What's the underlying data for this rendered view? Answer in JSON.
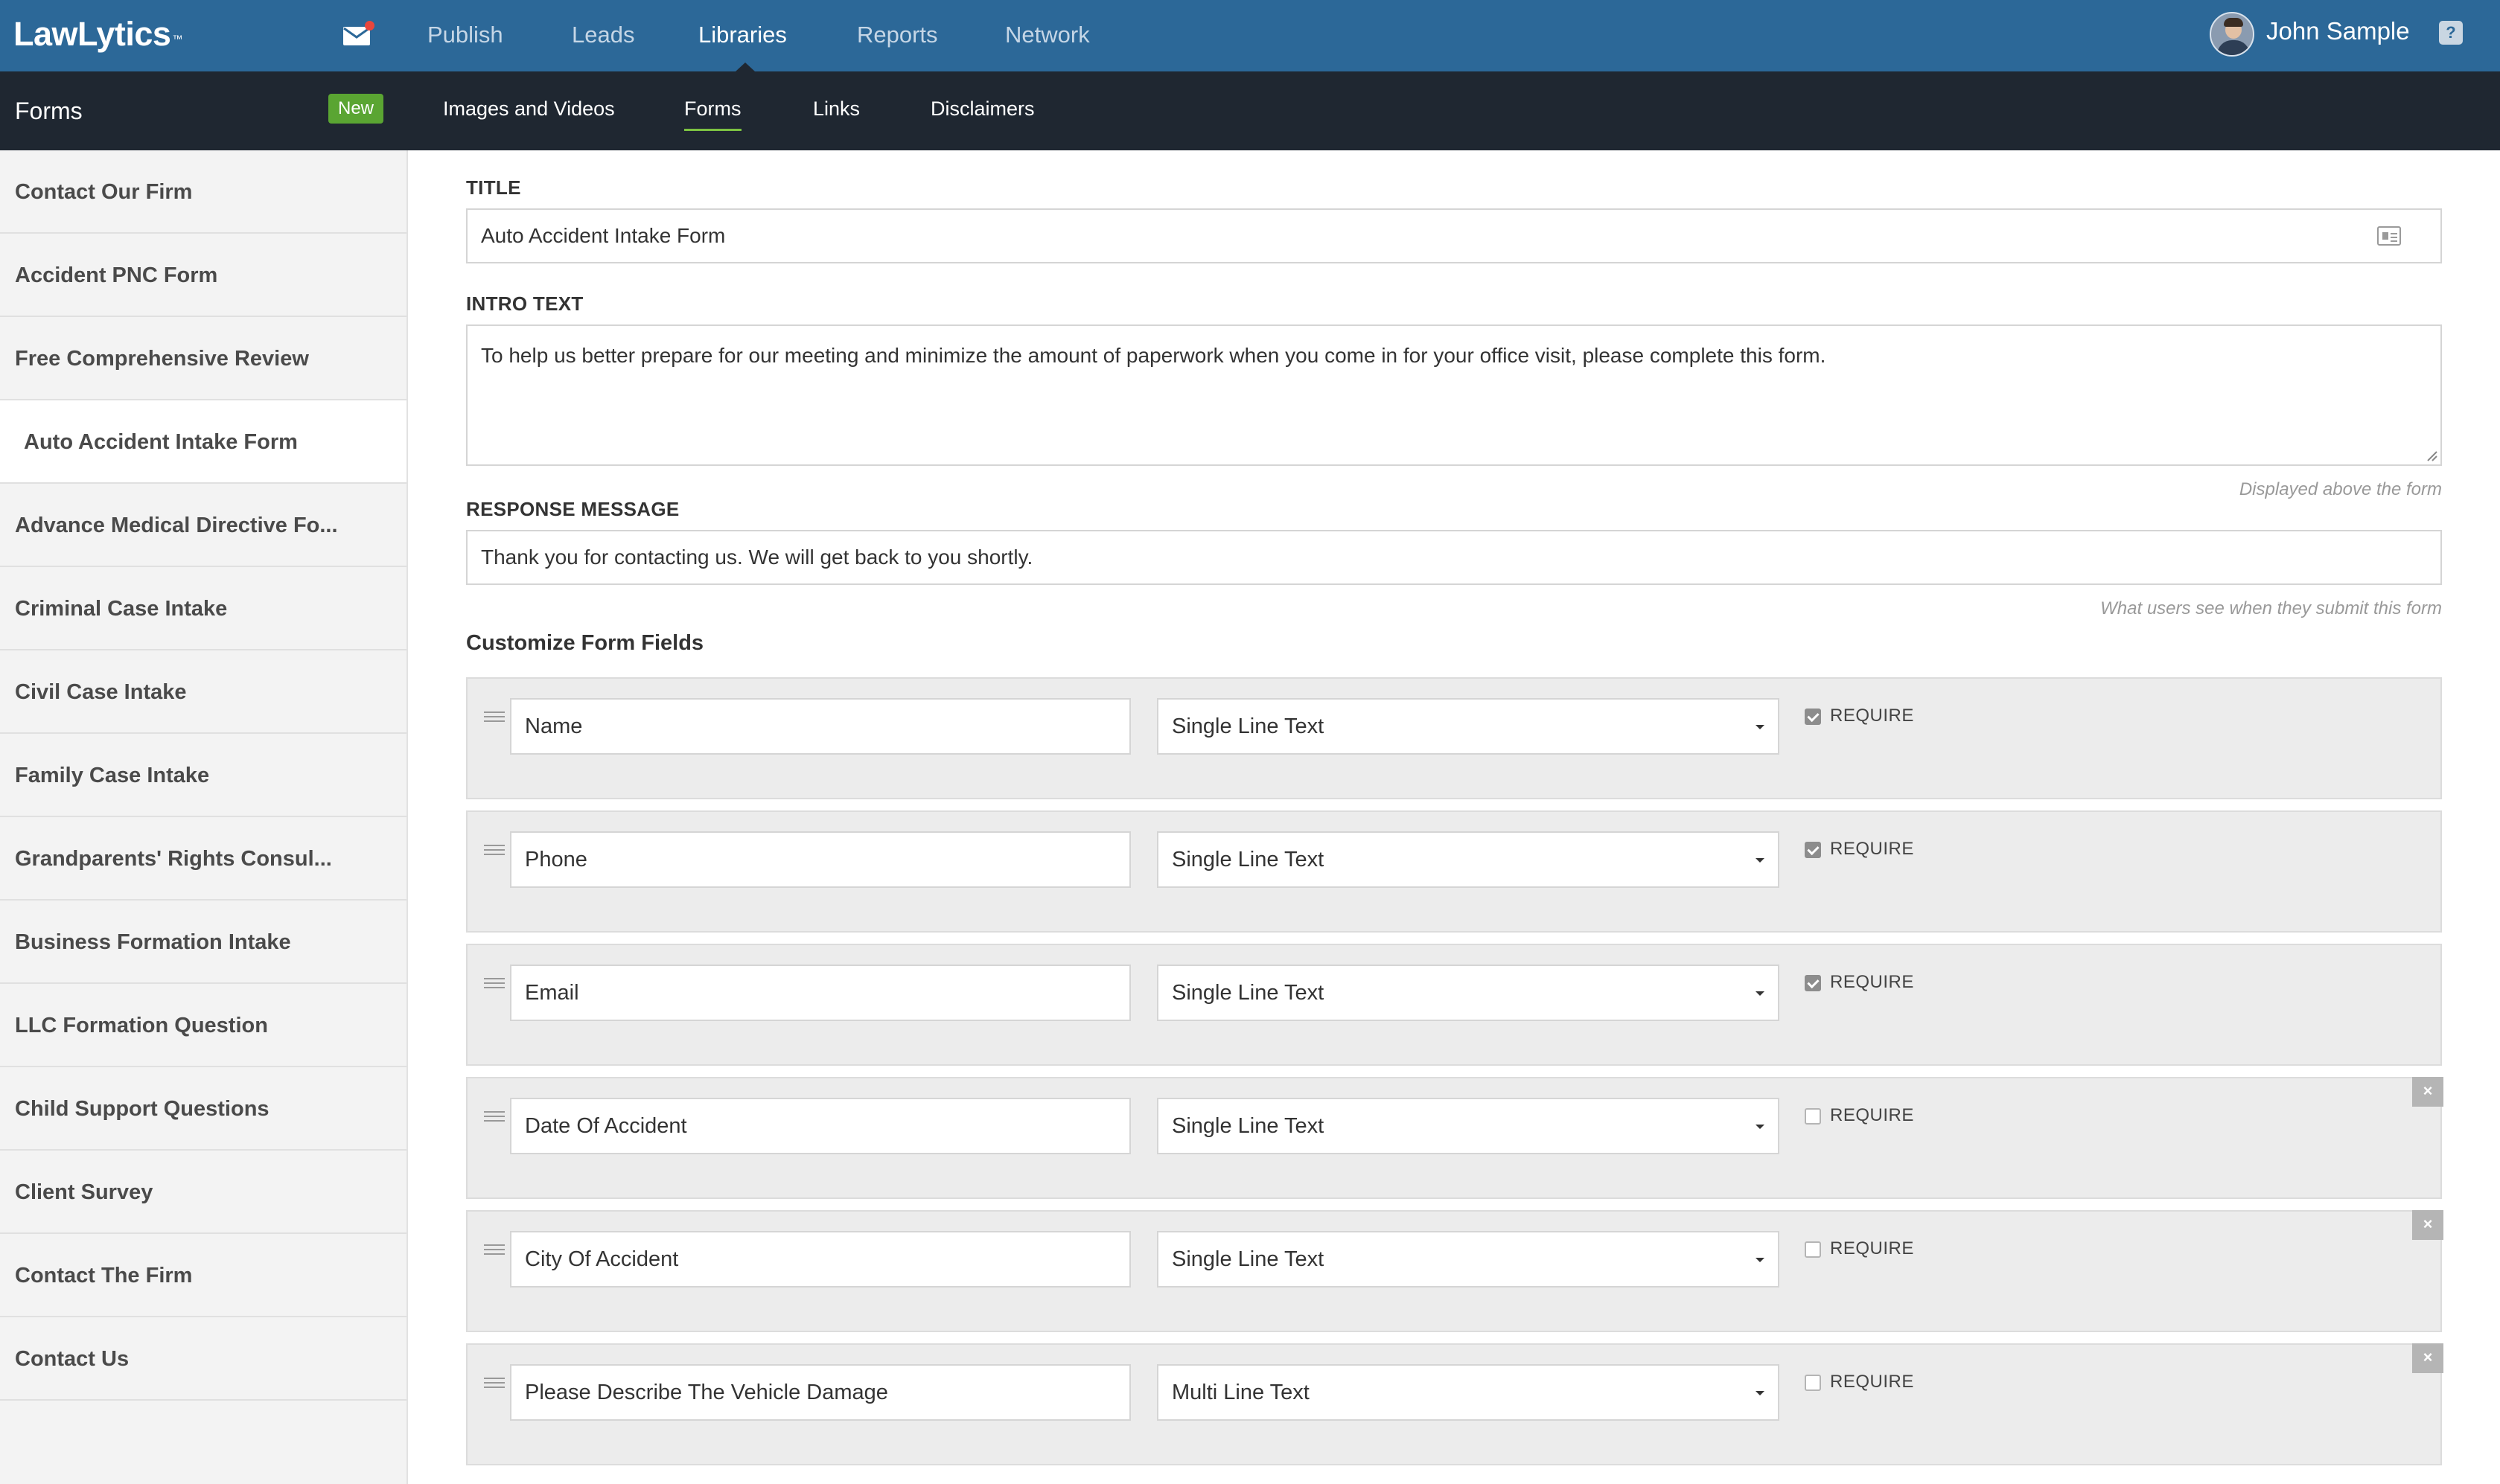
{
  "topbar": {
    "logo": "LawLytics",
    "logo_mark": "™",
    "mail_icon": "mail-icon",
    "nav": [
      "Publish",
      "Leads",
      "Libraries",
      "Reports",
      "Network"
    ],
    "active_nav": "Libraries",
    "user_name": "John Sample",
    "help_label": "?"
  },
  "subbar": {
    "title": "Forms",
    "new_label": "New",
    "tabs": [
      "Images and Videos",
      "Forms",
      "Links",
      "Disclaimers"
    ],
    "active_tab": "Forms"
  },
  "sidebar": {
    "items": [
      "Contact Our Firm",
      "Accident PNC Form",
      "Free Comprehensive Review",
      "Auto Accident Intake Form",
      "Advance Medical Directive Fo...",
      "Criminal Case Intake",
      "Civil Case Intake",
      "Family Case Intake",
      "Grandparents' Rights Consul...",
      "Business Formation Intake",
      "LLC Formation Question",
      "Child Support Questions",
      "Client Survey",
      "Contact The Firm",
      "Contact Us"
    ],
    "active_item": "Auto Accident Intake Form"
  },
  "form": {
    "title_label": "TITLE",
    "title_value": "Auto Accident Intake Form",
    "intro_label": "INTRO TEXT",
    "intro_value": "To help us better prepare for our meeting and minimize the amount of paperwork when you come in for your office visit, please complete this form.",
    "intro_hint": "Displayed above the form",
    "response_label": "RESPONSE MESSAGE",
    "response_value": "Thank you for contacting us.  We will get back to you shortly.",
    "response_hint": "What users see when they submit this form",
    "fields_title": "Customize Form Fields",
    "require_label": "REQUIRE",
    "remove_label": "×",
    "fields": [
      {
        "name": "Name",
        "type": "Single Line Text",
        "required": true,
        "removable": false
      },
      {
        "name": "Phone",
        "type": "Single Line Text",
        "required": true,
        "removable": false
      },
      {
        "name": "Email",
        "type": "Single Line Text",
        "required": true,
        "removable": false
      },
      {
        "name": "Date Of Accident",
        "type": "Single Line Text",
        "required": false,
        "removable": true
      },
      {
        "name": "City Of Accident",
        "type": "Single Line Text",
        "required": false,
        "removable": true
      },
      {
        "name": "Please Describe The Vehicle Damage",
        "type": "Multi Line Text",
        "required": false,
        "removable": true
      }
    ]
  },
  "colors": {
    "topbar": "#2c6898",
    "subbar": "#1f2731",
    "badge": "#5aa532",
    "active_underline": "#7cc242"
  }
}
